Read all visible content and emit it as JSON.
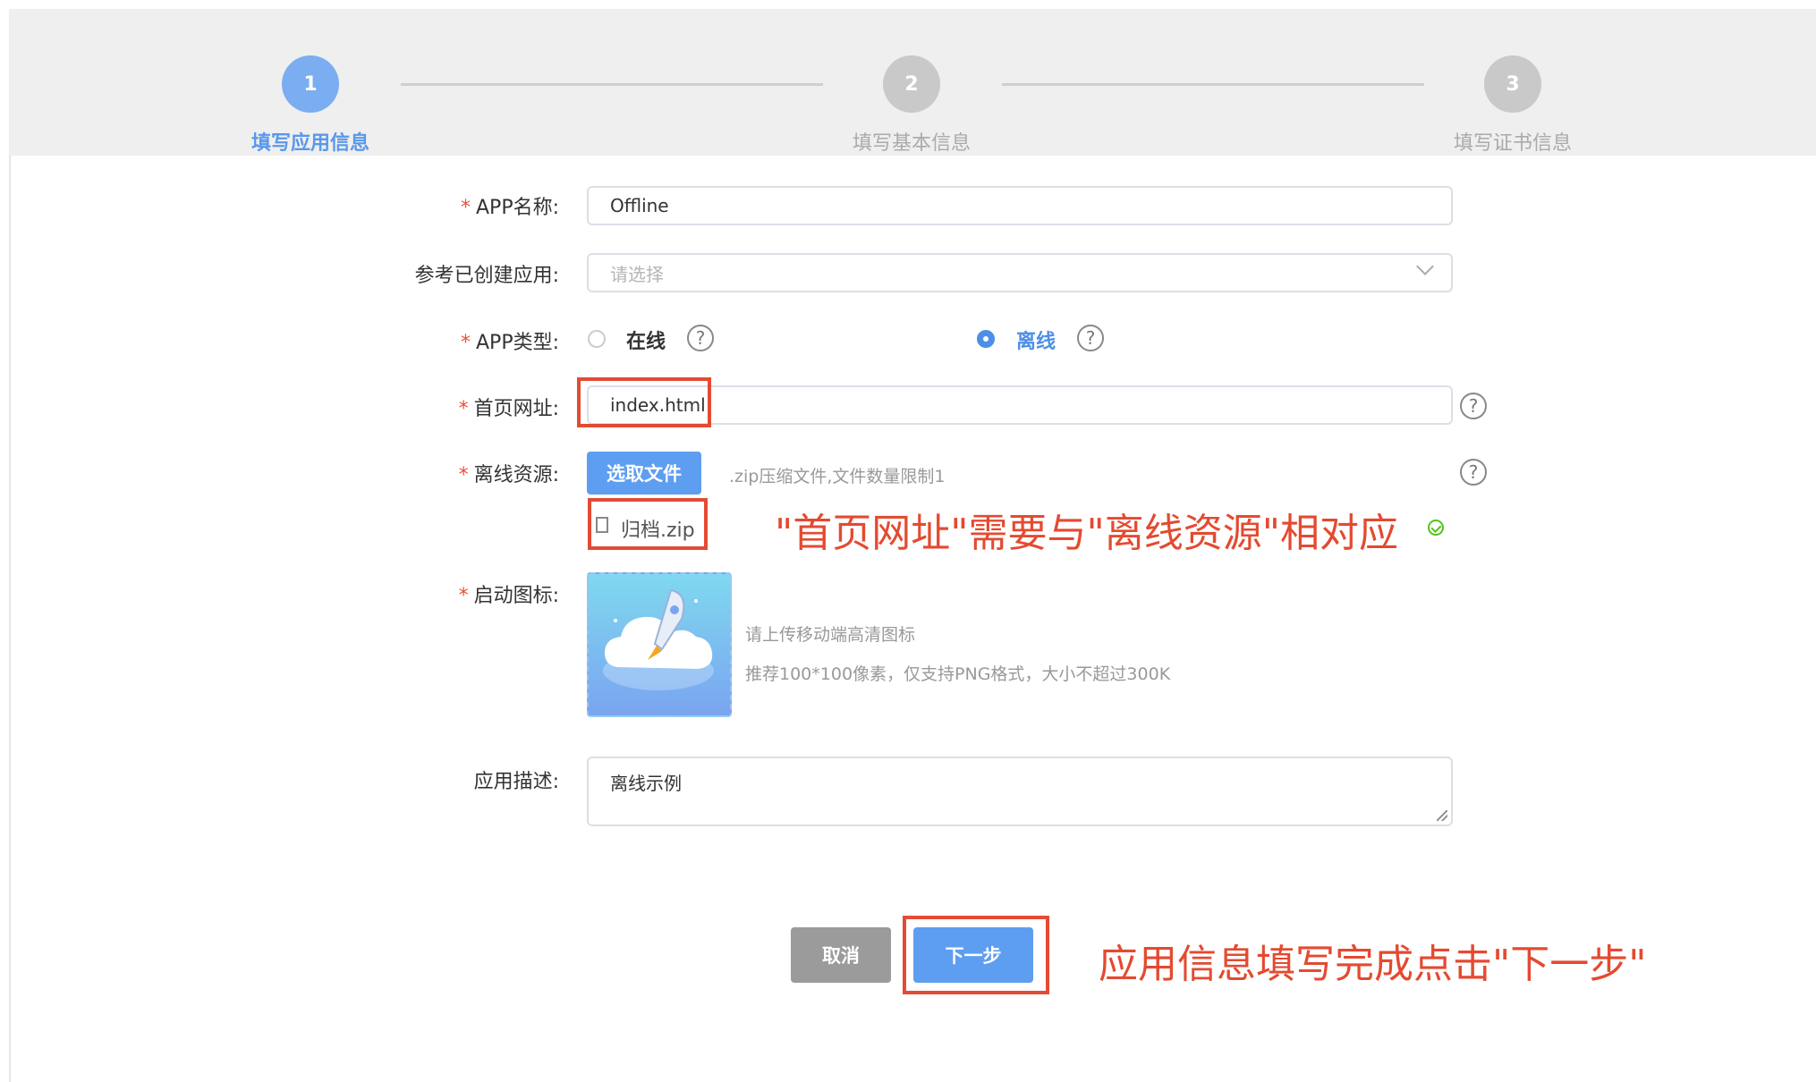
{
  "steps": [
    {
      "num": "1",
      "label": "填写应用信息"
    },
    {
      "num": "2",
      "label": "填写基本信息"
    },
    {
      "num": "3",
      "label": "填写证书信息"
    }
  ],
  "form": {
    "app_name_label": "APP名称:",
    "app_name_value": "Offline",
    "ref_label": "参考已创建应用:",
    "ref_placeholder": "请选择",
    "type_label": "APP类型:",
    "type_online": "在线",
    "type_offline": "离线",
    "homepage_label": "首页网址:",
    "homepage_value": "index.html",
    "offline_label": "离线资源:",
    "choose_file_button": "选取文件",
    "file_hint": ".zip压缩文件,文件数量限制1",
    "file_name": "归档.zip",
    "icon_label": "启动图标:",
    "icon_hint_1": "请上传移动端高清图标",
    "icon_hint_2": "推荐100*100像素，仅支持PNG格式，大小不超过300K",
    "desc_label": "应用描述:",
    "desc_value": "离线示例",
    "required_mark": "*",
    "help_glyph": "?"
  },
  "buttons": {
    "cancel": "取消",
    "next": "下一步"
  },
  "annotations": {
    "homepage_note": "\"首页网址\"需要与\"离线资源\"相对应",
    "next_note": "应用信息填写完成点击\"下一步\""
  },
  "colors": {
    "accent": "#4d8fe6",
    "annotation": "#e44a30",
    "step_active": "#7aaef0"
  }
}
